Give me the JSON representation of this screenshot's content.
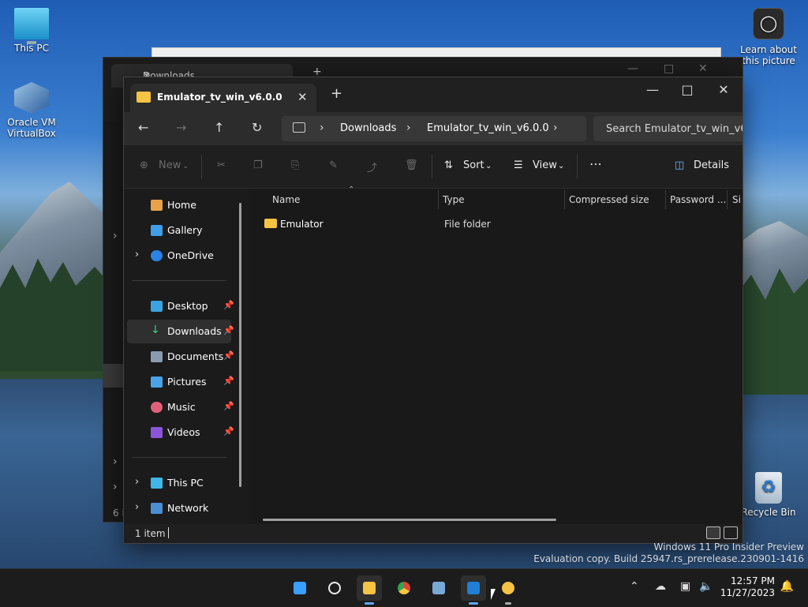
{
  "desktop": {
    "icons": {
      "this_pc": "This PC",
      "virtualbox_line1": "Oracle VM",
      "virtualbox_line2": "VirtualBox",
      "learn_line1": "Learn about",
      "learn_line2": "this picture",
      "recycle_bin": "Recycle Bin"
    }
  },
  "background_window": {
    "tab_label": "Downloads",
    "item_count_fragment": "6 i"
  },
  "window": {
    "tab_label": "Emulator_tv_win_v6.0.0",
    "breadcrumb": [
      "Downloads",
      "Emulator_tv_win_v6.0.0"
    ],
    "search_placeholder": "Search Emulator_tv_win_v6.0.0",
    "toolbar": {
      "new_label": "New",
      "sort_label": "Sort",
      "view_label": "View",
      "details_label": "Details"
    },
    "nav": {
      "home": "Home",
      "gallery": "Gallery",
      "onedrive": "OneDrive",
      "desktop": "Desktop",
      "downloads": "Downloads",
      "documents": "Documents",
      "pictures": "Pictures",
      "music": "Music",
      "videos": "Videos",
      "this_pc": "This PC",
      "network": "Network"
    },
    "columns": {
      "name": "Name",
      "type": "Type",
      "compressed_size": "Compressed size",
      "password": "Password ...",
      "size_fragment": "Si"
    },
    "files": [
      {
        "name": "Emulator",
        "type": "File folder"
      }
    ],
    "status": {
      "item_count": "1 item"
    }
  },
  "watermark": {
    "line1": "Windows 11 Pro Insider Preview",
    "line2": "Evaluation copy. Build 25947.rs_prerelease.230901-1416"
  },
  "taskbar": {
    "time": "12:57 PM",
    "date": "11/27/2023"
  },
  "colors": {
    "accent": "#61a8f5",
    "folder": "#f6c443",
    "downloads_green": "#3ad08a"
  }
}
